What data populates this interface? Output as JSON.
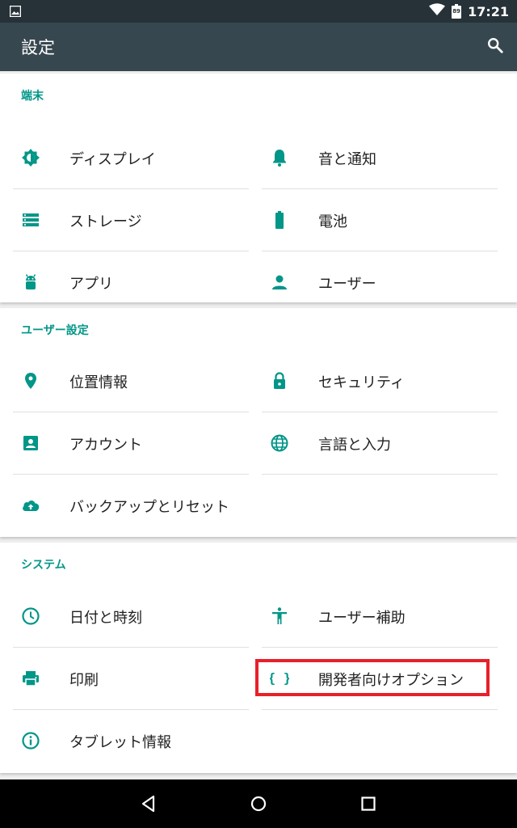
{
  "status_bar": {
    "time": "17:21",
    "battery_level": "89",
    "icons": [
      "image-notification-icon",
      "wifi-icon",
      "battery-icon"
    ]
  },
  "app_bar": {
    "title": "設定",
    "search_icon": "search-icon"
  },
  "sections": [
    {
      "title": "端末",
      "items": [
        {
          "label": "ディスプレイ",
          "icon": "brightness-icon"
        },
        {
          "label": "音と通知",
          "icon": "bell-icon"
        },
        {
          "label": "ストレージ",
          "icon": "storage-icon"
        },
        {
          "label": "電池",
          "icon": "battery-icon"
        },
        {
          "label": "アプリ",
          "icon": "android-icon"
        },
        {
          "label": "ユーザー",
          "icon": "person-icon"
        }
      ]
    },
    {
      "title": "ユーザー設定",
      "items": [
        {
          "label": "位置情報",
          "icon": "location-pin-icon"
        },
        {
          "label": "セキュリティ",
          "icon": "lock-icon"
        },
        {
          "label": "アカウント",
          "icon": "account-box-icon"
        },
        {
          "label": "言語と入力",
          "icon": "globe-icon"
        },
        {
          "label": "バックアップとリセット",
          "icon": "cloud-upload-icon"
        }
      ]
    },
    {
      "title": "システム",
      "items": [
        {
          "label": "日付と時刻",
          "icon": "clock-icon"
        },
        {
          "label": "ユーザー補助",
          "icon": "accessibility-icon"
        },
        {
          "label": "印刷",
          "icon": "printer-icon"
        },
        {
          "label": "開発者向けオプション",
          "icon": "code-braces-icon",
          "highlighted": true
        },
        {
          "label": "タブレット情報",
          "icon": "info-icon"
        }
      ]
    }
  ],
  "nav_bar": [
    "back-icon",
    "home-icon",
    "recents-icon"
  ],
  "colors": {
    "accent": "#009688",
    "status_bar": "#263238",
    "app_bar": "#37474f",
    "highlight": "#e8202a"
  }
}
